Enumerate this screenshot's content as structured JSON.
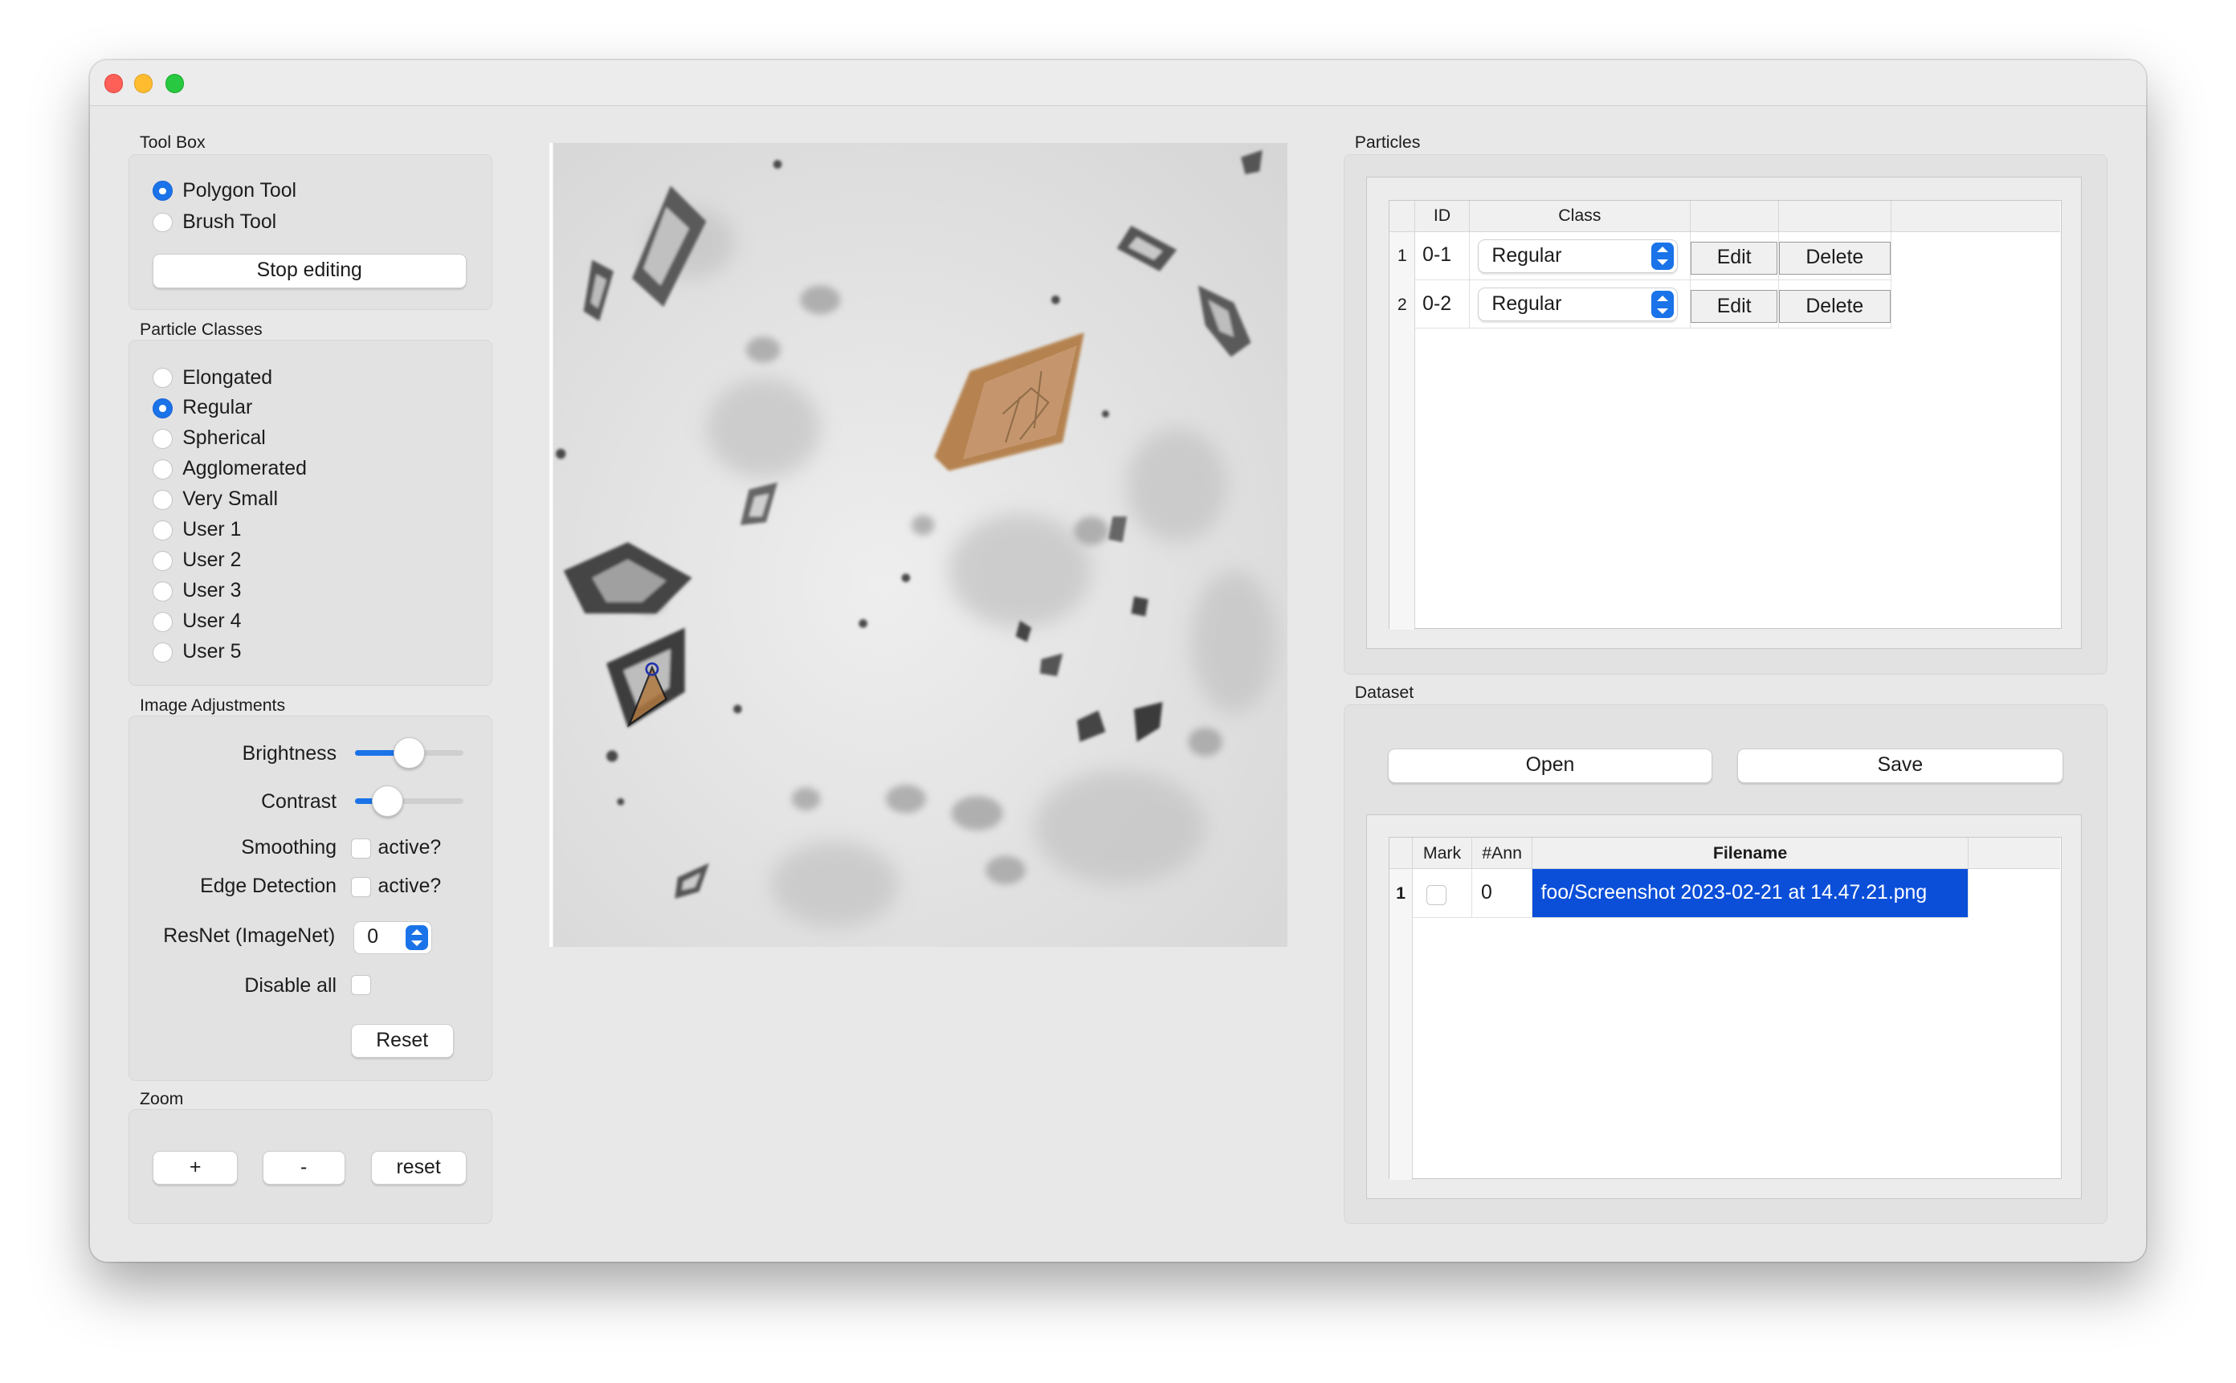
{
  "toolbox": {
    "title": "Tool Box",
    "tools": [
      {
        "label": "Polygon Tool",
        "selected": true
      },
      {
        "label": "Brush Tool",
        "selected": false
      }
    ],
    "stop_editing_label": "Stop editing"
  },
  "particle_classes": {
    "title": "Particle Classes",
    "items": [
      {
        "label": "Elongated",
        "selected": false
      },
      {
        "label": "Regular",
        "selected": true
      },
      {
        "label": "Spherical",
        "selected": false
      },
      {
        "label": "Agglomerated",
        "selected": false
      },
      {
        "label": "Very Small",
        "selected": false
      },
      {
        "label": "User 1",
        "selected": false
      },
      {
        "label": "User 2",
        "selected": false
      },
      {
        "label": "User 3",
        "selected": false
      },
      {
        "label": "User 4",
        "selected": false
      },
      {
        "label": "User 5",
        "selected": false
      }
    ]
  },
  "image_adjustments": {
    "title": "Image Adjustments",
    "brightness_label": "Brightness",
    "brightness_level": 0.5,
    "contrast_label": "Contrast",
    "contrast_level": 0.3,
    "smoothing_label": "Smoothing",
    "smoothing_checkbox_label": "active?",
    "smoothing_checked": false,
    "edge_label": "Edge Detection",
    "edge_checkbox_label": "active?",
    "edge_checked": false,
    "resnet_label": "ResNet (ImageNet)",
    "resnet_value": "0",
    "disable_all_label": "Disable all",
    "disable_all_checked": false,
    "reset_label": "Reset"
  },
  "zoom": {
    "title": "Zoom",
    "plus_label": "+",
    "minus_label": "-",
    "reset_label": "reset"
  },
  "particles": {
    "title": "Particles",
    "columns": [
      "ID",
      "Class",
      "",
      ""
    ],
    "rows": [
      {
        "num": "1",
        "id": "0-1",
        "class": "Regular",
        "edit": "Edit",
        "delete": "Delete"
      },
      {
        "num": "2",
        "id": "0-2",
        "class": "Regular",
        "edit": "Edit",
        "delete": "Delete"
      }
    ]
  },
  "dataset": {
    "title": "Dataset",
    "open_label": "Open",
    "save_label": "Save",
    "columns": [
      "Mark",
      "#Ann",
      "Filename"
    ],
    "rows": [
      {
        "num": "1",
        "mark": false,
        "ann": "0",
        "filename": "foo/Screenshot 2023-02-21 at 14.47.21.png",
        "selected": true
      }
    ]
  },
  "colors": {
    "accent": "#1a73e8",
    "selection": "#0b4fd9",
    "annotation_fill": "#b07840"
  }
}
